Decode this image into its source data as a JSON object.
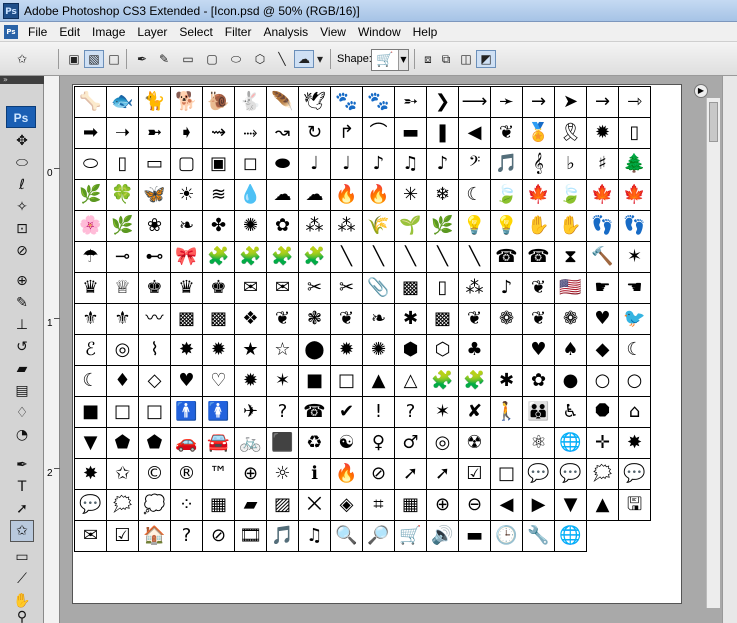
{
  "window": {
    "title": "Adobe Photoshop CS3 Extended - [Icon.psd @ 50% (RGB/16)]",
    "app_logo": "Ps"
  },
  "menu": [
    "File",
    "Edit",
    "Image",
    "Layer",
    "Select",
    "Filter",
    "Analysis",
    "View",
    "Window",
    "Help"
  ],
  "options_bar": {
    "shape_label": "Shape:",
    "shape_swatch": "🛒",
    "buttons": [
      {
        "name": "tool-preset-button",
        "glyph": "✩"
      },
      {
        "name": "shape-layers-button",
        "glyph": "▣"
      },
      {
        "name": "paths-button",
        "glyph": "▧"
      },
      {
        "name": "fill-pixels-button",
        "glyph": "□"
      },
      {
        "name": "pen-tool-option-button",
        "glyph": "✒"
      },
      {
        "name": "freeform-pen-option-button",
        "glyph": "✎"
      },
      {
        "name": "rectangle-option-button",
        "glyph": "▭"
      },
      {
        "name": "rounded-rectangle-option-button",
        "glyph": "▢"
      },
      {
        "name": "ellipse-option-button",
        "glyph": "⬭"
      },
      {
        "name": "polygon-option-button",
        "glyph": "⬡"
      },
      {
        "name": "line-option-button",
        "glyph": "╲"
      },
      {
        "name": "custom-shape-option-button",
        "glyph": "☁"
      },
      {
        "name": "geometry-options-button",
        "glyph": "▾"
      },
      {
        "name": "create-new-shape-area-button",
        "glyph": "⧈"
      },
      {
        "name": "add-to-shape-area-button",
        "glyph": "⧉"
      },
      {
        "name": "subtract-from-shape-area-button",
        "glyph": "◫"
      },
      {
        "name": "intersect-shape-areas-button",
        "glyph": "◩"
      }
    ]
  },
  "toolbox": {
    "badge": "Ps",
    "tools": [
      {
        "name": "move-tool",
        "glyph": "✥"
      },
      {
        "name": "marquee-tool",
        "glyph": "⬭"
      },
      {
        "name": "lasso-tool",
        "glyph": "ℓ"
      },
      {
        "name": "magic-wand-tool",
        "glyph": "✧"
      },
      {
        "name": "crop-tool",
        "glyph": "⊡"
      },
      {
        "name": "eyedropper-tool",
        "glyph": "⊘"
      },
      {
        "name": "healing-brush-tool",
        "glyph": "⊕"
      },
      {
        "name": "brush-tool",
        "glyph": "✎"
      },
      {
        "name": "clone-stamp-tool",
        "glyph": "⊥"
      },
      {
        "name": "history-brush-tool",
        "glyph": "↺"
      },
      {
        "name": "eraser-tool",
        "glyph": "▰"
      },
      {
        "name": "gradient-tool",
        "glyph": "▤"
      },
      {
        "name": "blur-tool",
        "glyph": "♢"
      },
      {
        "name": "dodge-tool",
        "glyph": "◔"
      },
      {
        "name": "pen-tool",
        "glyph": "✒"
      },
      {
        "name": "type-tool",
        "glyph": "T"
      },
      {
        "name": "path-selection-tool",
        "glyph": "➚"
      },
      {
        "name": "custom-shape-tool",
        "glyph": "✩"
      },
      {
        "name": "notes-tool",
        "glyph": "▭"
      },
      {
        "name": "eyedropper-tool-2",
        "glyph": "⟋"
      },
      {
        "name": "hand-tool",
        "glyph": "✋"
      },
      {
        "name": "zoom-tool",
        "glyph": "⚲"
      }
    ]
  },
  "ruler": {
    "labels": [
      "0",
      "1",
      "2"
    ]
  },
  "shapes_panel": {
    "shapes": [
      "🦴",
      "🐟",
      "🐈",
      "🐕",
      "🐌",
      "🐇",
      "🪶",
      "🕊",
      "🐾",
      "🐾",
      "➵",
      "❯",
      "⟶",
      "➛",
      "→",
      "➤",
      "→",
      "⇾",
      "➡",
      "➝",
      "➼",
      "➧",
      "⇝",
      "⤑",
      "↝",
      "↻",
      "↱",
      "⌒",
      "▬",
      "❚",
      "◀",
      "❦",
      "🏅",
      "🎗",
      "✹",
      "▯",
      "⬭",
      "▯",
      "▭",
      "▢",
      "▣",
      "◻",
      "⬬",
      "♩",
      "♩",
      "♪",
      "♫",
      "♪",
      "𝄢",
      "🎵",
      "𝄞",
      "♭",
      "♯",
      "🌲",
      "🌿",
      "🍀",
      "🦋",
      "☀",
      "≋",
      "💧",
      "☁",
      "☁",
      "🔥",
      "🔥",
      "✳",
      "❄",
      "☾",
      "🍃",
      "🍁",
      "🍃",
      "🍁",
      "🍁",
      "🌸",
      "🌿",
      "❀",
      "❧",
      "✤",
      "✺",
      "✿",
      "⁂",
      "⁂",
      "🌾",
      "🌱",
      "🌿",
      "💡",
      "💡",
      "✋",
      "✋",
      "👣",
      "👣",
      "☂",
      "⊸",
      "⊷",
      "🎀",
      "🧩",
      "🧩",
      "🧩",
      "🧩",
      "╲",
      "╲",
      "╲",
      "╲",
      "╲",
      "☎",
      "☎",
      "⧗",
      "🔨",
      "✶",
      "♛",
      "♕",
      "♚",
      "♛",
      "♚",
      "✉",
      "✉",
      "✂",
      "✂",
      "📎",
      "▩",
      "▯",
      "⁂",
      "♪",
      "❦",
      "🇺🇸",
      "☛",
      "☚",
      "⚜",
      "⚜",
      "〰",
      "▩",
      "▩",
      "❖",
      "❦",
      "❃",
      "❦",
      "❧",
      "✱",
      "▩",
      "❦",
      "❁",
      "❦",
      "❁",
      "♥",
      "🐦",
      "ℰ",
      "◎",
      "⌇",
      "✸",
      "✹",
      "★",
      "☆",
      "⬤",
      "✹",
      "✺",
      "⬢",
      "⬡",
      "♣",
      "",
      "♥",
      "♠",
      "◆",
      "☾",
      "☾",
      "♦",
      "◇",
      "♥",
      "♡",
      "✹",
      "✶",
      "■",
      "□",
      "▲",
      "△",
      "🧩",
      "🧩",
      "✱",
      "✿",
      "●",
      "○",
      "○",
      "■",
      "□",
      "□",
      "🚹",
      "🚺",
      "✈",
      "?",
      "☎",
      "✔",
      "!",
      "?",
      "✶",
      "✘",
      "🚶",
      "👪",
      "♿",
      "⯃",
      "⌂",
      "▼",
      "⬟",
      "⬟",
      "🚗",
      "🚘",
      "🚲",
      "⬛",
      "♻",
      "☯",
      "♀",
      "♂",
      "◎",
      "☢",
      "",
      "⚛",
      "🌐",
      "✛",
      "✸",
      "✸",
      "✩",
      "©",
      "®",
      "™",
      "⊕",
      "☼",
      "ℹ",
      "🔥",
      "⊘",
      "➚",
      "➚",
      "☑",
      "□",
      "💬",
      "💬",
      "🗯",
      "💬",
      "💬",
      "🗯",
      "💭",
      "⁘",
      "▦",
      "▰",
      "▨",
      "⨉",
      "◈",
      "⌗",
      "▦",
      "⊕",
      "⊖",
      "◀",
      "▶",
      "▼",
      "▲",
      "🖫",
      "✉",
      "☑",
      "🏠",
      "?",
      "⊘",
      "🎞",
      "🎵",
      "♫",
      "🔍",
      "🔎",
      "🛒",
      "🔊",
      "▬",
      "🕒",
      "🔧",
      "🌐"
    ]
  }
}
